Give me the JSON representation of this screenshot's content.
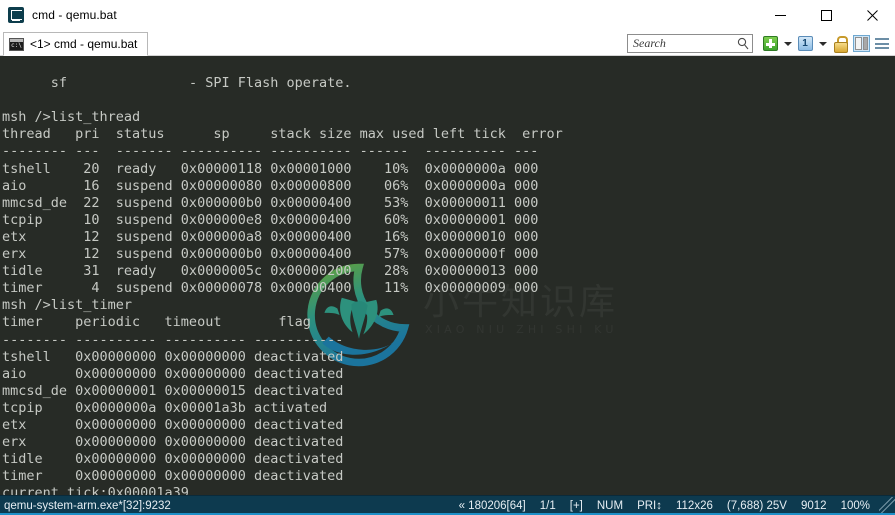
{
  "window": {
    "title": "cmd - qemu.bat",
    "app_icon": "conemu-icon",
    "controls": {
      "minimize": "minimize-icon",
      "maximize": "maximize-icon",
      "close": "close-icon"
    }
  },
  "tabbar": {
    "tabs": [
      {
        "label": "<1> cmd - qemu.bat",
        "icon": "console-icon",
        "active": true
      }
    ],
    "search": {
      "placeholder": "Search",
      "value": "",
      "icon": "search-icon"
    },
    "toolbar_icons": [
      {
        "name": "new-console-icon",
        "label": "+"
      },
      {
        "name": "new-console-dropdown-icon",
        "label": ""
      },
      {
        "name": "active-console-icon",
        "label": "1"
      },
      {
        "name": "active-console-dropdown-icon",
        "label": ""
      },
      {
        "name": "lock-icon",
        "label": ""
      },
      {
        "name": "split-panel-icon",
        "label": ""
      },
      {
        "name": "menu-icon",
        "label": ""
      }
    ]
  },
  "terminal": {
    "background_color": "#272b26",
    "text_color": "#c6c9c4",
    "lines": [
      "sf               - SPI Flash operate.",
      "",
      "msh />list_thread",
      "thread   pri  status      sp     stack size max used left tick  error",
      "-------- ---  ------- ---------- ---------- ------  ---------- ---",
      "tshell    20  ready   0x00000118 0x00001000    10%  0x0000000a 000",
      "aio       16  suspend 0x00000080 0x00000800    06%  0x0000000a 000",
      "mmcsd_de  22  suspend 0x000000b0 0x00000400    53%  0x00000011 000",
      "tcpip     10  suspend 0x000000e8 0x00000400    60%  0x00000001 000",
      "etx       12  suspend 0x000000a8 0x00000400    16%  0x00000010 000",
      "erx       12  suspend 0x000000b0 0x00000400    57%  0x0000000f 000",
      "tidle     31  ready   0x0000005c 0x00000200    28%  0x00000013 000",
      "timer      4  suspend 0x00000078 0x00000400    11%  0x00000009 000",
      "msh />list_timer",
      "timer    periodic   timeout       flag",
      "-------- ---------- ---------- -----------",
      "tshell   0x00000000 0x00000000 deactivated",
      "aio      0x00000000 0x00000000 deactivated",
      "mmcsd_de 0x00000001 0x00000015 deactivated",
      "tcpip    0x0000000a 0x00001a3b activated",
      "etx      0x00000000 0x00000000 deactivated",
      "erx      0x00000000 0x00000000 deactivated",
      "tidle    0x00000000 0x00000000 deactivated",
      "timer    0x00000000 0x00000000 deactivated",
      "current tick:0x00001a39"
    ],
    "prompt": "msh />",
    "cursor": "block-cursor"
  },
  "watermark": {
    "cn_text": "小牛知识库",
    "en_text": "XIAO NIU ZHI SHI KU",
    "logo": "ox-head-logo"
  },
  "statusbar": {
    "process": "qemu-system-arm.exe*[32]:9232",
    "cells": [
      "« 180206[64]",
      "1/1",
      "[+]",
      "NUM",
      "PRI↕",
      "112x26",
      "(7,688) 25V",
      "9012",
      "100%"
    ],
    "background_color": "#0d3a4f",
    "accent_color": "#1e90c8",
    "grip": "resize-grip-icon"
  }
}
